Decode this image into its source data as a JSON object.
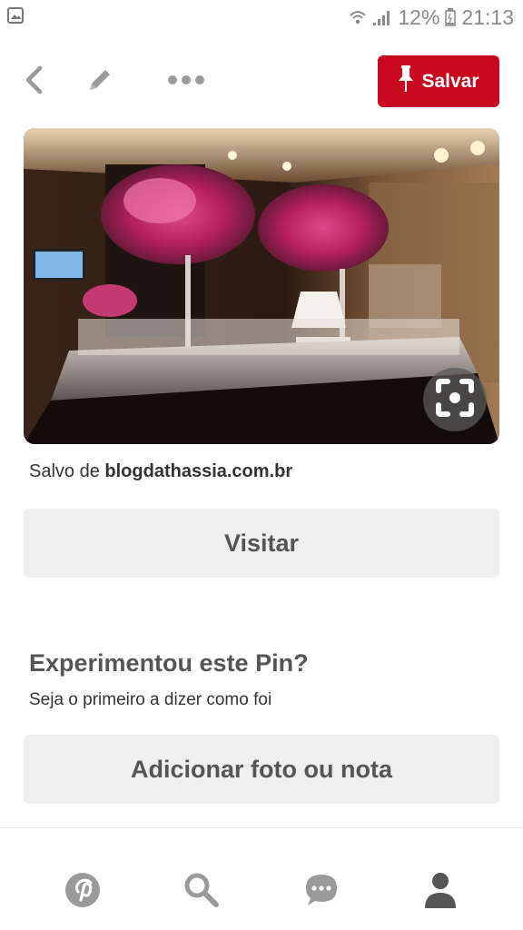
{
  "status_bar": {
    "battery_percent": "12%",
    "time": "21:13"
  },
  "toolbar": {
    "save_label": "Salvar"
  },
  "pin": {
    "source_prefix": "Salvo de",
    "source_domain": "blogdathassia.com.br"
  },
  "actions": {
    "visit_label": "Visitar"
  },
  "tried": {
    "title": "Experimentou este Pin?",
    "subtitle": "Seja o primeiro a dizer como foi",
    "add_label": "Adicionar foto ou nota"
  },
  "colors": {
    "accent": "#c8081f",
    "button_bg": "#efefef",
    "icon_gray": "#8e8e8e",
    "icon_active": "#555555"
  }
}
